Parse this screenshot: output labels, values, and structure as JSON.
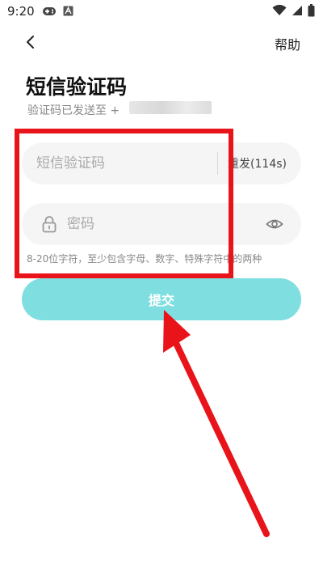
{
  "status_bar": {
    "time": "9:20"
  },
  "nav": {
    "help_label": "帮助"
  },
  "header": {
    "title": "短信验证码",
    "subtitle": "验证码已发送至 +"
  },
  "code_field": {
    "placeholder": "短信验证码",
    "resend_label": "重发(114s)"
  },
  "password_field": {
    "placeholder": "密码",
    "hint": "8-20位字符，至少包含字母、数字、特殊字符中的两种"
  },
  "submit": {
    "label": "提交"
  },
  "colors": {
    "accent": "#7fdfe0",
    "annotation": "#e8141a",
    "field_bg": "#f5f5f5"
  },
  "icons": [
    "back-arrow-icon",
    "lock-icon",
    "eye-icon",
    "wifi-icon",
    "signal-icon",
    "battery-icon",
    "gamepad-icon",
    "notification-a-icon"
  ]
}
